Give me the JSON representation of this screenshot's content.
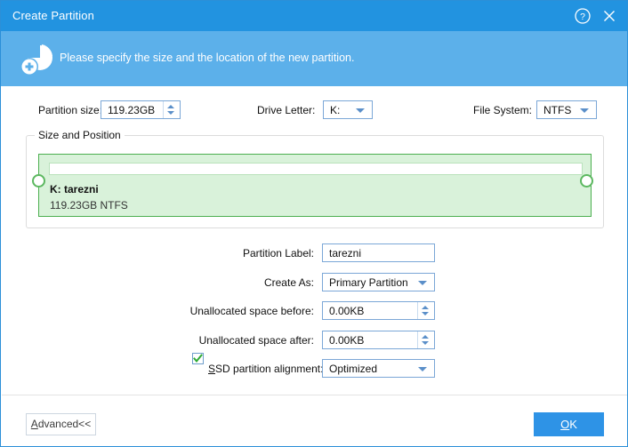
{
  "window": {
    "title": "Create Partition",
    "help_icon": "help-circle-icon",
    "close_icon": "close-icon"
  },
  "banner": {
    "icon": "partition-disk-add-icon",
    "message": "Please specify the size and the location of the new partition."
  },
  "top_row": {
    "partition_size": {
      "label": "Partition size:",
      "value": "119.23GB",
      "control": "spinner"
    },
    "drive_letter": {
      "label": "Drive Letter:",
      "value": "K:",
      "control": "dropdown"
    },
    "file_system": {
      "label": "File System:",
      "value": "NTFS",
      "control": "dropdown"
    }
  },
  "size_and_position": {
    "group_label": "Size and Position",
    "partition": {
      "name": "K: tarezni",
      "info": "119.23GB NTFS",
      "bar_color": "#d9f2da",
      "border_color": "#4caf50"
    },
    "handles": {
      "left": "resize-handle-left",
      "right": "resize-handle-right"
    }
  },
  "fields": {
    "partition_label": {
      "label": "Partition Label:",
      "value": "tarezni",
      "control": "text"
    },
    "create_as": {
      "label": "Create As:",
      "value": "Primary Partition",
      "control": "dropdown"
    },
    "unallocated_before": {
      "label": "Unallocated space before:",
      "value": "0.00KB",
      "control": "spinner"
    },
    "unallocated_after": {
      "label": "Unallocated space after:",
      "value": "0.00KB",
      "control": "spinner"
    },
    "ssd_alignment": {
      "label_prefix": "S",
      "label_rest": "SD partition alignment:",
      "checked": true,
      "value": "Optimized",
      "control": "dropdown"
    }
  },
  "footer": {
    "advanced": {
      "accel": "A",
      "rest": "dvanced<<"
    },
    "ok": {
      "accel": "O",
      "rest": "K"
    },
    "ok_color": "#2e93e6"
  }
}
